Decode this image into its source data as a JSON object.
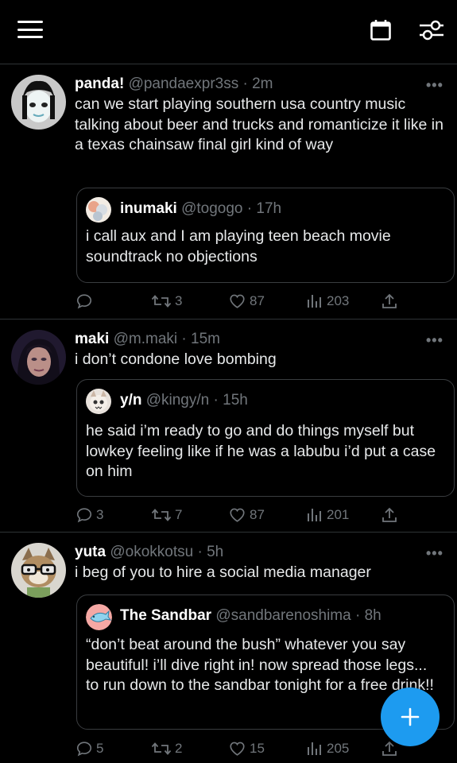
{
  "topbar": {
    "menu_icon": "hamburger-menu-icon",
    "calendar_icon": "calendar-icon",
    "filter_icon": "sliders-icon"
  },
  "tweets": [
    {
      "name": "panda!",
      "handle": "@pandaexpr3ss",
      "time": "· 2m",
      "text": "can we start playing southern usa country music talking about beer and trucks and romanticize it like in a texas chainsaw final girl kind of way",
      "quote": {
        "name": "inumaki",
        "handle": "@togogo",
        "time": "· 17h",
        "text": "i call aux and I am playing teen beach movie soundtrack no objections"
      },
      "stats": {
        "replies": "",
        "retweets": "3",
        "likes": "87",
        "views": "203"
      }
    },
    {
      "name": "maki",
      "handle": "@m.maki",
      "time": "· 15m",
      "text": "i don’t condone love bombing",
      "quote": {
        "name": "y/n",
        "handle": "@kingy/n",
        "time": "· 15h",
        "text": "he said i’m ready to go and do things myself but lowkey feeling like if he was a labubu i’d put a case on him"
      },
      "stats": {
        "replies": "3",
        "retweets": "7",
        "likes": "87",
        "views": "201"
      }
    },
    {
      "name": "yuta",
      "handle": "@okokkotsu",
      "time": "· 5h",
      "text": "i beg of you to hire a social media manager",
      "quote": {
        "name": "The Sandbar",
        "handle": "@sandbarenoshima",
        "time": "· 8h",
        "text": "“don’t beat around the bush” whatever you say beautiful! i’ll dive right in! now spread those legs... to run down to the sandbar tonight for a free drink!!"
      },
      "stats": {
        "replies": "5",
        "retweets": "2",
        "likes": "15",
        "views": "205"
      }
    }
  ],
  "more_label": "•••",
  "fab": {
    "icon": "plus-icon",
    "label": "+"
  },
  "colors": {
    "background": "#000000",
    "accent": "#1d9bf0",
    "muted": "#71767b",
    "divider": "#2f3336"
  }
}
